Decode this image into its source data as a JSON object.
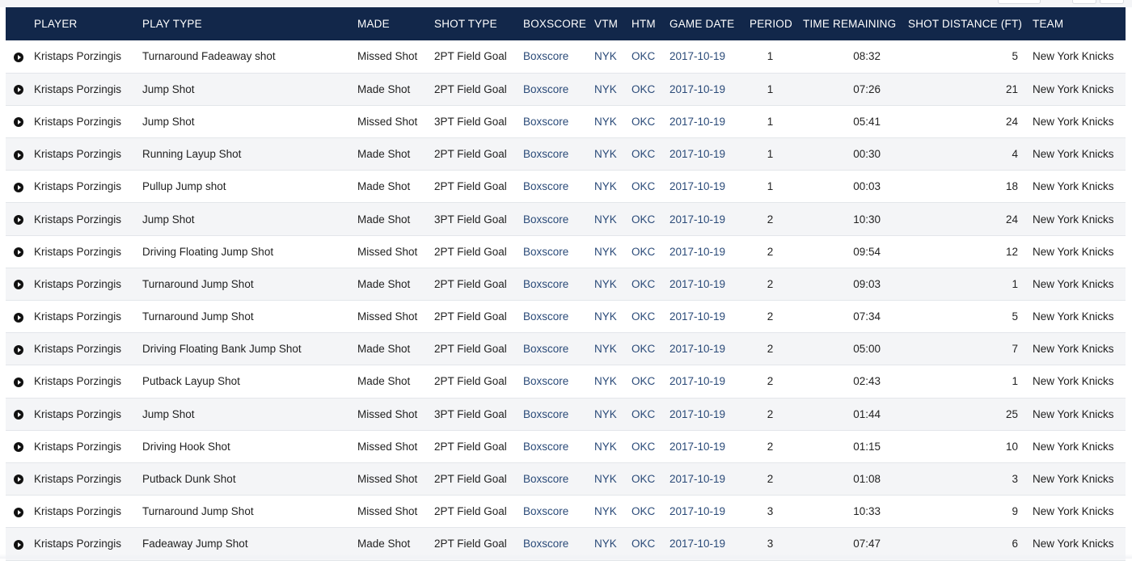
{
  "columns": {
    "player": "PLAYER",
    "play_type": "PLAY TYPE",
    "made": "MADE",
    "shot_type": "SHOT TYPE",
    "boxscore": "BOXSCORE",
    "vtm": "VTM",
    "htm": "HTM",
    "game_date": "GAME DATE",
    "period": "PERIOD",
    "time_remaining": "TIME REMAINING",
    "shot_distance": "SHOT DISTANCE (FT)",
    "team": "TEAM"
  },
  "icons": {
    "play": "play-circle-icon"
  },
  "colors": {
    "header_bg": "#12274a",
    "link": "#2a4a78",
    "stripe": "#f4f5f7"
  },
  "rows": [
    {
      "player": "Kristaps Porzingis",
      "play_type": "Turnaround Fadeaway shot",
      "made": "Missed Shot",
      "shot_type": "2PT Field Goal",
      "boxscore": "Boxscore",
      "vtm": "NYK",
      "htm": "OKC",
      "game_date": "2017-10-19",
      "period": "1",
      "time_remaining": "08:32",
      "shot_distance": "5",
      "team": "New York Knicks"
    },
    {
      "player": "Kristaps Porzingis",
      "play_type": "Jump Shot",
      "made": "Made Shot",
      "shot_type": "2PT Field Goal",
      "boxscore": "Boxscore",
      "vtm": "NYK",
      "htm": "OKC",
      "game_date": "2017-10-19",
      "period": "1",
      "time_remaining": "07:26",
      "shot_distance": "21",
      "team": "New York Knicks"
    },
    {
      "player": "Kristaps Porzingis",
      "play_type": "Jump Shot",
      "made": "Missed Shot",
      "shot_type": "3PT Field Goal",
      "boxscore": "Boxscore",
      "vtm": "NYK",
      "htm": "OKC",
      "game_date": "2017-10-19",
      "period": "1",
      "time_remaining": "05:41",
      "shot_distance": "24",
      "team": "New York Knicks"
    },
    {
      "player": "Kristaps Porzingis",
      "play_type": "Running Layup Shot",
      "made": "Made Shot",
      "shot_type": "2PT Field Goal",
      "boxscore": "Boxscore",
      "vtm": "NYK",
      "htm": "OKC",
      "game_date": "2017-10-19",
      "period": "1",
      "time_remaining": "00:30",
      "shot_distance": "4",
      "team": "New York Knicks"
    },
    {
      "player": "Kristaps Porzingis",
      "play_type": "Pullup Jump shot",
      "made": "Made Shot",
      "shot_type": "2PT Field Goal",
      "boxscore": "Boxscore",
      "vtm": "NYK",
      "htm": "OKC",
      "game_date": "2017-10-19",
      "period": "1",
      "time_remaining": "00:03",
      "shot_distance": "18",
      "team": "New York Knicks"
    },
    {
      "player": "Kristaps Porzingis",
      "play_type": "Jump Shot",
      "made": "Made Shot",
      "shot_type": "3PT Field Goal",
      "boxscore": "Boxscore",
      "vtm": "NYK",
      "htm": "OKC",
      "game_date": "2017-10-19",
      "period": "2",
      "time_remaining": "10:30",
      "shot_distance": "24",
      "team": "New York Knicks"
    },
    {
      "player": "Kristaps Porzingis",
      "play_type": "Driving Floating Jump Shot",
      "made": "Missed Shot",
      "shot_type": "2PT Field Goal",
      "boxscore": "Boxscore",
      "vtm": "NYK",
      "htm": "OKC",
      "game_date": "2017-10-19",
      "period": "2",
      "time_remaining": "09:54",
      "shot_distance": "12",
      "team": "New York Knicks"
    },
    {
      "player": "Kristaps Porzingis",
      "play_type": "Turnaround Jump Shot",
      "made": "Made Shot",
      "shot_type": "2PT Field Goal",
      "boxscore": "Boxscore",
      "vtm": "NYK",
      "htm": "OKC",
      "game_date": "2017-10-19",
      "period": "2",
      "time_remaining": "09:03",
      "shot_distance": "1",
      "team": "New York Knicks"
    },
    {
      "player": "Kristaps Porzingis",
      "play_type": "Turnaround Jump Shot",
      "made": "Missed Shot",
      "shot_type": "2PT Field Goal",
      "boxscore": "Boxscore",
      "vtm": "NYK",
      "htm": "OKC",
      "game_date": "2017-10-19",
      "period": "2",
      "time_remaining": "07:34",
      "shot_distance": "5",
      "team": "New York Knicks"
    },
    {
      "player": "Kristaps Porzingis",
      "play_type": "Driving Floating Bank Jump Shot",
      "made": "Made Shot",
      "shot_type": "2PT Field Goal",
      "boxscore": "Boxscore",
      "vtm": "NYK",
      "htm": "OKC",
      "game_date": "2017-10-19",
      "period": "2",
      "time_remaining": "05:00",
      "shot_distance": "7",
      "team": "New York Knicks"
    },
    {
      "player": "Kristaps Porzingis",
      "play_type": "Putback Layup Shot",
      "made": "Made Shot",
      "shot_type": "2PT Field Goal",
      "boxscore": "Boxscore",
      "vtm": "NYK",
      "htm": "OKC",
      "game_date": "2017-10-19",
      "period": "2",
      "time_remaining": "02:43",
      "shot_distance": "1",
      "team": "New York Knicks"
    },
    {
      "player": "Kristaps Porzingis",
      "play_type": "Jump Shot",
      "made": "Missed Shot",
      "shot_type": "3PT Field Goal",
      "boxscore": "Boxscore",
      "vtm": "NYK",
      "htm": "OKC",
      "game_date": "2017-10-19",
      "period": "2",
      "time_remaining": "01:44",
      "shot_distance": "25",
      "team": "New York Knicks"
    },
    {
      "player": "Kristaps Porzingis",
      "play_type": "Driving Hook Shot",
      "made": "Missed Shot",
      "shot_type": "2PT Field Goal",
      "boxscore": "Boxscore",
      "vtm": "NYK",
      "htm": "OKC",
      "game_date": "2017-10-19",
      "period": "2",
      "time_remaining": "01:15",
      "shot_distance": "10",
      "team": "New York Knicks"
    },
    {
      "player": "Kristaps Porzingis",
      "play_type": "Putback Dunk Shot",
      "made": "Missed Shot",
      "shot_type": "2PT Field Goal",
      "boxscore": "Boxscore",
      "vtm": "NYK",
      "htm": "OKC",
      "game_date": "2017-10-19",
      "period": "2",
      "time_remaining": "01:08",
      "shot_distance": "3",
      "team": "New York Knicks"
    },
    {
      "player": "Kristaps Porzingis",
      "play_type": "Turnaround Jump Shot",
      "made": "Missed Shot",
      "shot_type": "2PT Field Goal",
      "boxscore": "Boxscore",
      "vtm": "NYK",
      "htm": "OKC",
      "game_date": "2017-10-19",
      "period": "3",
      "time_remaining": "10:33",
      "shot_distance": "9",
      "team": "New York Knicks"
    },
    {
      "player": "Kristaps Porzingis",
      "play_type": "Fadeaway Jump Shot",
      "made": "Made Shot",
      "shot_type": "2PT Field Goal",
      "boxscore": "Boxscore",
      "vtm": "NYK",
      "htm": "OKC",
      "game_date": "2017-10-19",
      "period": "3",
      "time_remaining": "07:47",
      "shot_distance": "6",
      "team": "New York Knicks"
    }
  ]
}
